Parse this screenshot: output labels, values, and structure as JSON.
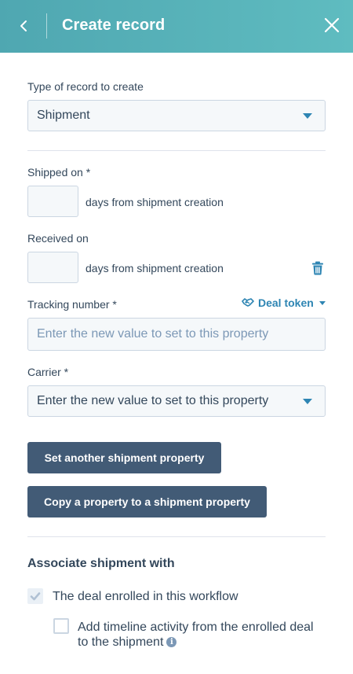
{
  "header": {
    "title": "Create record"
  },
  "record_type": {
    "label": "Type of record to create",
    "value": "Shipment"
  },
  "shipped_on": {
    "label": "Shipped on *",
    "suffix": "days from shipment creation"
  },
  "received_on": {
    "label": "Received on",
    "suffix": "days from shipment creation"
  },
  "tracking_number": {
    "label": "Tracking number *",
    "token_label": "Deal token",
    "placeholder": "Enter the new value to set to this property"
  },
  "carrier": {
    "label": "Carrier *",
    "value": "Enter the new value to set to this property"
  },
  "buttons": {
    "set_another": "Set another shipment property",
    "copy_property": "Copy a property to a shipment property"
  },
  "associate": {
    "title": "Associate shipment with",
    "option_deal": "The deal enrolled in this workflow",
    "option_deal_checked": true,
    "option_timeline_line1": "Add timeline activity from the enrolled deal",
    "option_timeline_line2": "to the shipment",
    "option_timeline_checked": false
  },
  "colors": {
    "header_start": "#4fa7b1",
    "header_end": "#5fbcc0",
    "button_bg": "#425b76",
    "link_blue": "#2e85b3",
    "text": "#33475b"
  },
  "icons": {
    "back": "chevron-left-icon",
    "close": "close-icon",
    "trash": "trash-icon",
    "token": "handshake-icon",
    "info": "info-icon"
  }
}
